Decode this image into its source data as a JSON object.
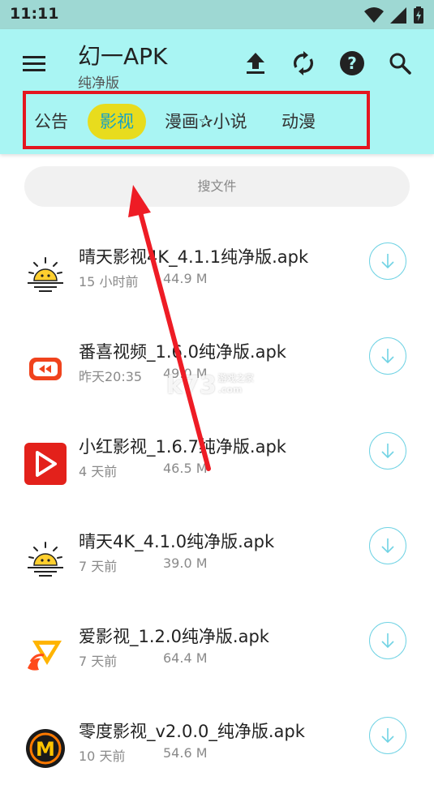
{
  "status_bar": {
    "time": "11:11"
  },
  "app_bar": {
    "title": "幻一APK",
    "subtitle": "纯净版",
    "actions": [
      "upload-icon",
      "refresh-icon",
      "help-icon",
      "search-icon"
    ]
  },
  "tabs": [
    {
      "label": "公告",
      "active": false
    },
    {
      "label": "影视",
      "active": true
    },
    {
      "label": "漫画✰小说",
      "active": false
    },
    {
      "label": "动漫",
      "active": false
    }
  ],
  "search": {
    "placeholder": "搜文件"
  },
  "files": [
    {
      "name": "晴天影视4K_4.1.1纯净版.apk",
      "time": "15 小时前",
      "size": "44.9 M",
      "icon": "sun-icon"
    },
    {
      "name": "番喜视频_1.6.0纯净版.apk",
      "time": "昨天20:35",
      "size": "49.0 M",
      "icon": "rewind-icon"
    },
    {
      "name": "小红影视_1.6.7纯净版.apk",
      "time": "4 天前",
      "size": "46.5 M",
      "icon": "play-icon"
    },
    {
      "name": "晴天4K_4.1.0纯净版.apk",
      "time": "7 天前",
      "size": "39.0 M",
      "icon": "sun-icon"
    },
    {
      "name": "爱影视_1.2.0纯净版.apk",
      "time": "7 天前",
      "size": "64.4 M",
      "icon": "flame-play-icon"
    },
    {
      "name": "零度影视_v2.0.0_纯净版.apk",
      "time": "10 天前",
      "size": "54.6 M",
      "icon": "m-logo-icon"
    }
  ],
  "watermark": {
    "brand": "k73",
    "tagline": "游戏之家",
    "domain": ".com"
  },
  "colors": {
    "appbar": "#a9f5f3",
    "active_tab": "#e8dc1d",
    "highlight_box": "#e4161f",
    "download_ring": "#71d3e4"
  }
}
